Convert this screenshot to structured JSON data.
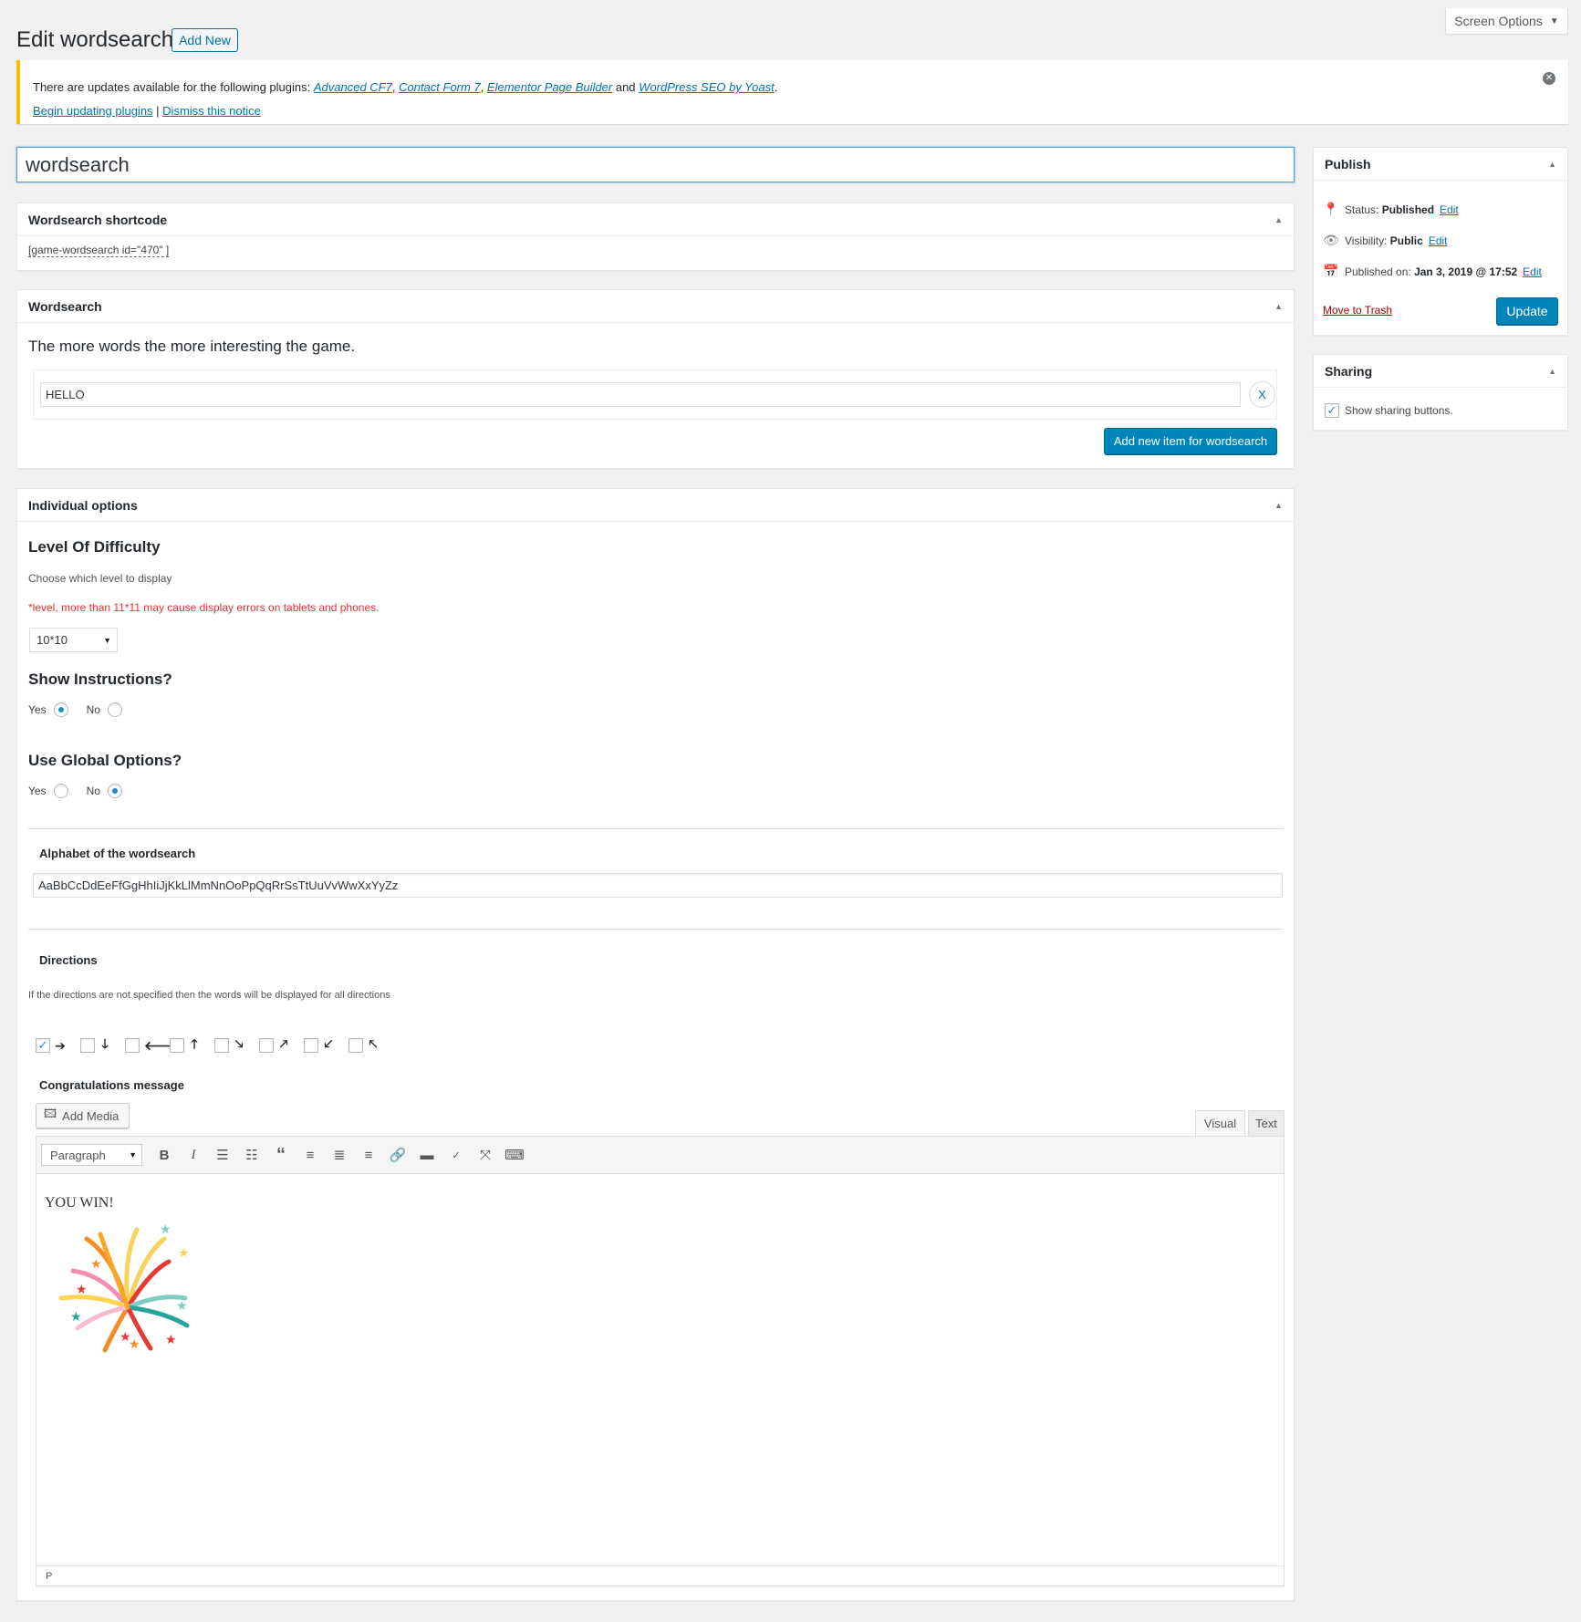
{
  "header": {
    "page_title": "Edit wordsearch",
    "add_new_label": "Add New",
    "screen_options_label": "Screen Options"
  },
  "notice": {
    "text_before": "There are updates available for the following plugins: ",
    "plugins": [
      "Advanced CF7",
      "Contact Form 7",
      "Elementor Page Builder",
      "WordPress SEO by Yoast"
    ],
    "sep1": ", ",
    "sep2": ", ",
    "and": " and ",
    "period": ".",
    "begin_updating": "Begin updating plugins",
    "divider": " | ",
    "dismiss": "Dismiss this notice"
  },
  "post_title": "wordsearch",
  "shortcode_box": {
    "title": "Wordsearch shortcode",
    "shortcode": "[game-wordsearch id=\"470\" ]"
  },
  "wordsearch_box": {
    "title": "Wordsearch",
    "intro": "The more words the more interesting the game.",
    "words": [
      "HELLO"
    ],
    "remove_label": "X",
    "add_item_label": "Add new item for wordsearch"
  },
  "options_box": {
    "title": "Individual options",
    "difficulty_heading": "Level Of Difficulty",
    "difficulty_sub": "Choose which level to display",
    "difficulty_warning": "*level, more than 11*11 may cause display errors on tablets and phones.",
    "difficulty_value": "10*10",
    "instructions_heading": "Show Instructions?",
    "instructions_yes": "Yes",
    "instructions_no": "No",
    "instructions_selected": "Yes",
    "global_heading": "Use Global Options?",
    "global_yes": "Yes",
    "global_no": "No",
    "global_selected": "No",
    "alphabet_label": "Alphabet of the wordsearch",
    "alphabet_value": "AaBbCcDdEeFfGgHhIiJjKkLlMmNnOoPpQqRrSsTtUuVvWwXxYyZz",
    "directions_label": "Directions",
    "directions_note": "If the directions are not specified then the words will be displayed for all directions",
    "directions": [
      {
        "arrow": "➔",
        "icon": "arrow-right-icon",
        "checked": true
      },
      {
        "arrow": "🡓",
        "icon": "arrow-down-icon",
        "checked": false
      },
      {
        "arrow": "🡐",
        "icon": "arrow-left-icon",
        "checked": false
      },
      {
        "arrow": "🡑",
        "icon": "arrow-up-icon",
        "checked": false
      },
      {
        "arrow": "🡖",
        "icon": "arrow-down-right-icon",
        "checked": false
      },
      {
        "arrow": "🡕",
        "icon": "arrow-up-right-icon",
        "checked": false
      },
      {
        "arrow": "🡗",
        "icon": "arrow-down-left-icon",
        "checked": false
      },
      {
        "arrow": "🡔",
        "icon": "arrow-up-left-icon",
        "checked": false
      }
    ],
    "congrats_label": "Congratulations message",
    "add_media_label": "Add Media",
    "tab_visual": "Visual",
    "tab_text": "Text",
    "format_select": "Paragraph",
    "editor_content": "YOU WIN!",
    "editor_path": "P"
  },
  "publish_box": {
    "title": "Publish",
    "status_label": "Status: ",
    "status_value": "Published",
    "visibility_label": "Visibility: ",
    "visibility_value": "Public",
    "published_label": "Published on: ",
    "published_value": "Jan 3, 2019 @ 17:52",
    "edit_label": "Edit",
    "trash_label": "Move to Trash",
    "update_label": "Update"
  },
  "sharing_box": {
    "title": "Sharing",
    "checkbox_label": "Show sharing buttons.",
    "checked": true
  },
  "colors": {
    "accent": "#0085ba",
    "link": "#0073aa",
    "warning_border": "#ffb900",
    "error_text": "#dc3232"
  }
}
